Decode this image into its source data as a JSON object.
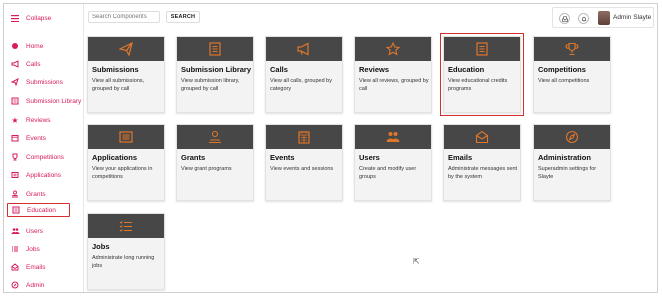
{
  "sidebar": {
    "collapse_label": "Collapse",
    "items": [
      {
        "label": "Home",
        "icon": "home-icon"
      },
      {
        "label": "Calls",
        "icon": "megaphone-icon"
      },
      {
        "label": "Submissions",
        "icon": "paper-plane-icon"
      },
      {
        "label": "Submission Library",
        "icon": "library-icon"
      },
      {
        "label": "Reviews",
        "icon": "star-icon"
      },
      {
        "label": "Events",
        "icon": "calendar-icon"
      },
      {
        "label": "Competitions",
        "icon": "trophy-icon"
      },
      {
        "label": "Applications",
        "icon": "applications-icon"
      },
      {
        "label": "Grants",
        "icon": "grants-icon"
      },
      {
        "label": "Education",
        "icon": "education-icon"
      },
      {
        "label": "Users",
        "icon": "users-icon"
      },
      {
        "label": "Jobs",
        "icon": "jobs-icon"
      },
      {
        "label": "Emails",
        "icon": "email-icon"
      },
      {
        "label": "Admin",
        "icon": "admin-icon"
      }
    ]
  },
  "header": {
    "search_placeholder": "Search Components",
    "search_button": "SEARCH",
    "user_name": "Admin Slayte"
  },
  "cards": [
    {
      "title": "Submissions",
      "desc": "View all submissions, grouped by call",
      "icon": "paper-plane-icon"
    },
    {
      "title": "Submission Library",
      "desc": "View submission library, grouped by call",
      "icon": "library-icon"
    },
    {
      "title": "Calls",
      "desc": "View all calls, grouped by category",
      "icon": "megaphone-icon"
    },
    {
      "title": "Reviews",
      "desc": "View all reviews, grouped by call",
      "icon": "star-icon"
    },
    {
      "title": "Education",
      "desc": "View educational credits programs",
      "icon": "education-icon"
    },
    {
      "title": "Competitions",
      "desc": "View all competitions",
      "icon": "trophy-icon"
    },
    {
      "title": "Applications",
      "desc": "View your applications in competitions",
      "icon": "applications-icon"
    },
    {
      "title": "Grants",
      "desc": "View grant programs",
      "icon": "grants-icon"
    },
    {
      "title": "Events",
      "desc": "View events and sessions",
      "icon": "calendar-icon"
    },
    {
      "title": "Users",
      "desc": "Create and modify user groups",
      "icon": "users-icon"
    },
    {
      "title": "Emails",
      "desc": "Administrate messages sent by the system",
      "icon": "email-icon"
    },
    {
      "title": "Administration",
      "desc": "Superadmin settings for Slayte",
      "icon": "compass-icon"
    },
    {
      "title": "Jobs",
      "desc": "Administrate long running jobs",
      "icon": "jobs-icon"
    }
  ],
  "colors": {
    "accent": "#d81b60",
    "card_band": "#474747",
    "card_icon": "#e0762a",
    "selection": "#d32f2f"
  }
}
